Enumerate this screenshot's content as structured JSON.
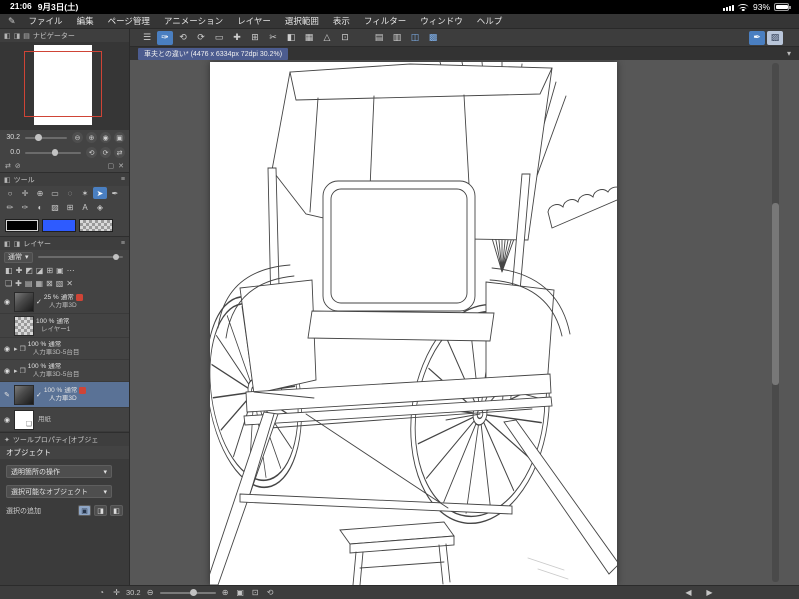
{
  "status_bar": {
    "time": "21:06",
    "date": "9月3日(土)",
    "battery_percent": "93%"
  },
  "menu_bar": {
    "pencil": "✎",
    "items": [
      "ファイル",
      "編集",
      "ページ管理",
      "アニメーション",
      "レイヤー",
      "選択範囲",
      "表示",
      "フィルター",
      "ウィンドウ",
      "ヘルプ"
    ]
  },
  "toolbar": {
    "icons": [
      "☰",
      "✑",
      "⟲",
      "⟳",
      "▭",
      "✚",
      "⊞",
      "✂",
      "◧",
      "▦",
      "△",
      "⊡",
      "▤",
      "▥",
      "◫",
      "▩",
      "✒",
      "▨"
    ]
  },
  "tab_bar": {
    "document_title": "車夫との違い* (4476 x 6334px 72dpi 30.2%)",
    "caret": "▾"
  },
  "navigator": {
    "title": "ナビゲーター",
    "header_icons": [
      "◧",
      "◨",
      "▤"
    ],
    "zoom_value": "30.2",
    "rotate_value": "0.0",
    "zoom_icons": [
      "⊖",
      "⊕",
      "◉",
      "▣"
    ],
    "rotate_icons": [
      "⟲",
      "⟳",
      "⇄"
    ],
    "footer_icons": [
      "⇄",
      "⊘",
      "▢",
      "✕"
    ]
  },
  "tool_panel": {
    "title": "ツール",
    "row1": [
      "○",
      "✛",
      "⊕",
      "▭",
      "◌",
      "✶",
      "➤",
      "✒"
    ],
    "row2": [
      "✏",
      "✑",
      "◐",
      "▨",
      "⊞",
      "A",
      "◈"
    ]
  },
  "color_panel": {
    "primary_hex": "#000000",
    "secondary_hex": "#2e5bff"
  },
  "layer_panel": {
    "title": "レイヤー",
    "header_icons": [
      "◧",
      "◨"
    ],
    "menu_icon": "≡",
    "blend_mode": "通常",
    "caret": "▾",
    "toolbar_row1": [
      "◧",
      "✚",
      "◩",
      "◪",
      "⊞",
      "▣",
      "⋯"
    ],
    "toolbar_row2": [
      "❏",
      "✚",
      "▤",
      "▦",
      "⊠",
      "▧",
      "✕"
    ],
    "eye_icon": "◉",
    "check_icon": "✓",
    "pencil_icon": "✎",
    "folder_arrow": "▸",
    "folder_icon": "❐",
    "layers": [
      {
        "opacity": "25 %",
        "blend": "通常",
        "name": "人力車3D"
      },
      {
        "opacity": "100 %",
        "blend": "通常",
        "name": "レイヤー1"
      },
      {
        "opacity": "100 %",
        "blend": "通常",
        "name": "人力車3D-5台目"
      },
      {
        "opacity": "100 %",
        "blend": "通常",
        "name": "人力車3D-5台目"
      },
      {
        "opacity": "100 %",
        "blend": "通常",
        "name": "人力車3D"
      },
      {
        "name": "用紙"
      }
    ]
  },
  "tool_property": {
    "title": "ツールプロパティ[オブジェ",
    "menu_icon": "✦",
    "tool_name": "オブジェクト",
    "dropdown1": "透明箇所の操作",
    "dropdown2": "選択可能なオブジェクト",
    "caret": "▾",
    "selection_label": "選択の追加",
    "selection_icons": [
      "▣",
      "◨",
      "◧"
    ]
  },
  "bottom_bar": {
    "zoom_value": "30.2",
    "icons_left": [
      "◔",
      "✛"
    ],
    "zoom_out": "⊖",
    "zoom_in": "⊕",
    "icons_mid": [
      "▣",
      "⊡",
      "⟲"
    ],
    "nav_prev": "◀",
    "nav_next": "▶"
  }
}
